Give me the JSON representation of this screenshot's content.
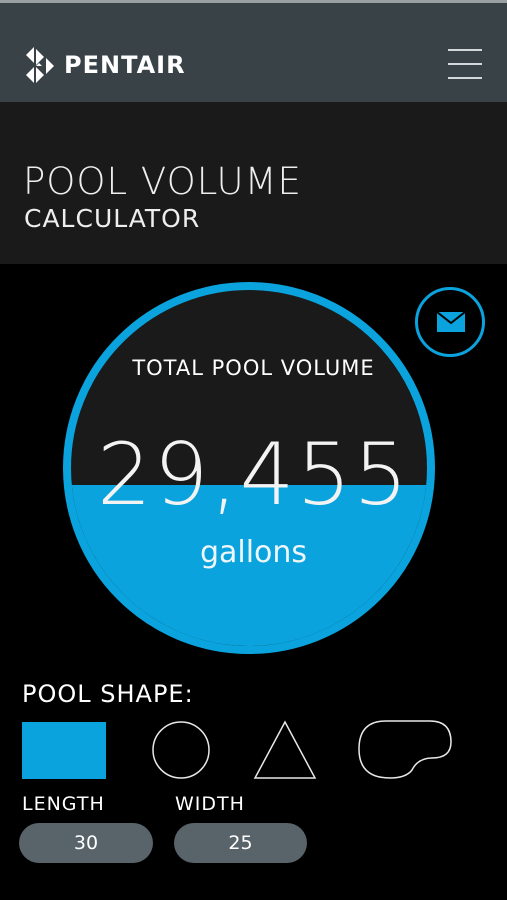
{
  "header": {
    "brand": "PENTAIR",
    "logo_icon": "pentair-diamond-icon",
    "menu_icon": "hamburger-menu-icon"
  },
  "page": {
    "title": "POOL VOLUME",
    "subtitle": "CALCULATOR"
  },
  "result": {
    "label": "TOTAL POOL VOLUME",
    "value": "29,455",
    "unit": "gallons",
    "email_icon": "envelope-icon"
  },
  "shape_selector": {
    "label": "POOL SHAPE:",
    "options": [
      {
        "name": "rectangle",
        "selected": true
      },
      {
        "name": "circle",
        "selected": false
      },
      {
        "name": "triangle",
        "selected": false
      },
      {
        "name": "kidney",
        "selected": false
      }
    ]
  },
  "dimensions": {
    "length_label": "LENGTH",
    "length_value": "30",
    "width_label": "WIDTH",
    "width_value": "25"
  },
  "colors": {
    "accent": "#0aa3dd",
    "header_bg": "#394246",
    "title_bg": "#1a1a1a",
    "input_bg": "#59646a"
  }
}
